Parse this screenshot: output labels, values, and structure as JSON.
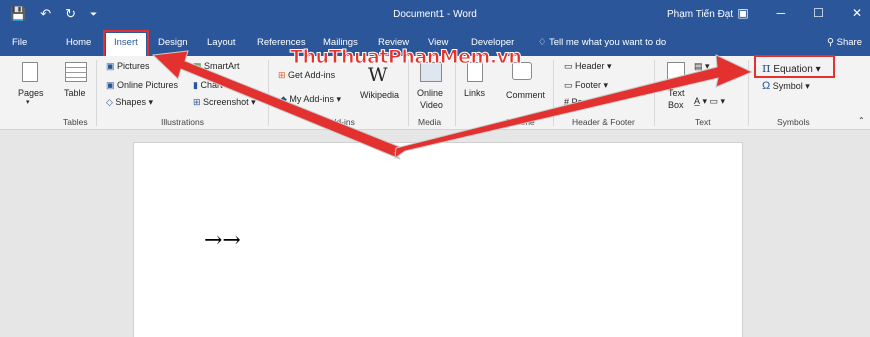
{
  "titlebar": {
    "title": "Document1 - Word",
    "user": "Phạm Tiến Đạt",
    "save_icon": "💾",
    "undo_icon": "↶",
    "redo_icon": "↻",
    "customize_icon": "⏷",
    "ribbon_display_icon": "▣",
    "minimize_icon": "─",
    "maximize_icon": "☐",
    "close_icon": "✕"
  },
  "tabs": [
    "File",
    "Home",
    "Insert",
    "Design",
    "Layout",
    "References",
    "Mailings",
    "Review",
    "View",
    "Developer"
  ],
  "tell_me": "Tell me what you want to do",
  "share": "Share",
  "ribbon": {
    "pages": "Pages",
    "table": "Table",
    "tables_group": "Tables",
    "pictures": "Pictures",
    "online_pictures": "Online Pictures",
    "shapes": "Shapes",
    "smartart": "SmartArt",
    "chart": "Chart",
    "screenshot": "Screenshot",
    "illustrations_group": "Illustrations",
    "get_addins": "Get Add-ins",
    "my_addins": "My Add-ins",
    "wikipedia": "Wikipedia",
    "wiki_letter": "W",
    "addins_group": "Add-ins",
    "online": "Online",
    "video": "Video",
    "media_group": "Media",
    "links": "Links",
    "comment": "Comment",
    "comments_group": "Comme",
    "header": "Header",
    "footer": "Footer",
    "page_number": "Page N",
    "header_footer_group": "Header & Footer",
    "text_box_1": "Text",
    "text_box_2": "Box",
    "text_group": "Text",
    "equation": "Equation",
    "equation_symbol": "π",
    "symbol": "Symbol",
    "symbol_symbol": "Ω",
    "symbols_group": "Symbols"
  },
  "document": {
    "content": "→→"
  },
  "watermark": "ThuThuatPhanMem.vn",
  "colors": {
    "word_blue": "#2b579a",
    "highlight_red": "#e2312e"
  }
}
